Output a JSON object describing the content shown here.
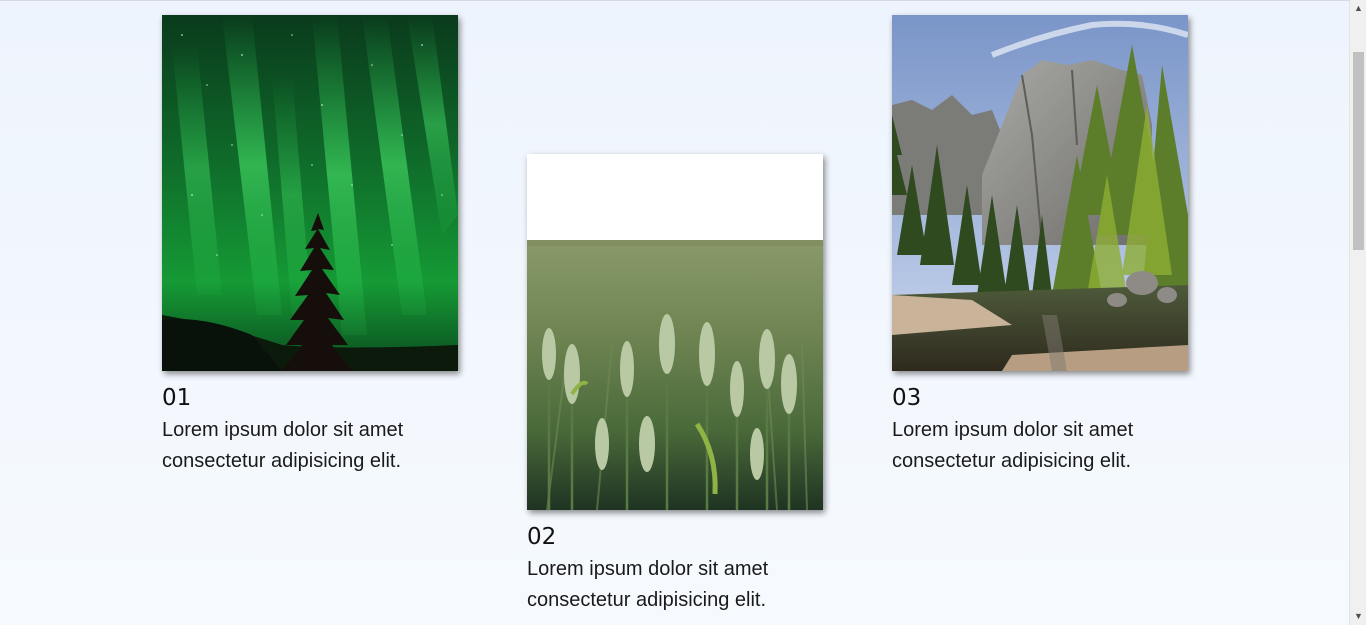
{
  "cards": [
    {
      "number": "01",
      "text": "Lorem ipsum dolor sit amet consectetur adipisicing elit.",
      "image": "aurora-night-photo"
    },
    {
      "number": "02",
      "text": "Lorem ipsum dolor sit amet consectetur adipisicing elit.",
      "image": "wheat-field-photo"
    },
    {
      "number": "03",
      "text": "Lorem ipsum dolor sit amet consectetur adipisicing elit.",
      "image": "mountain-forest-river-photo"
    }
  ],
  "scrollbar": {
    "up_icon": "chevron-up-icon",
    "down_icon": "chevron-down-icon"
  }
}
